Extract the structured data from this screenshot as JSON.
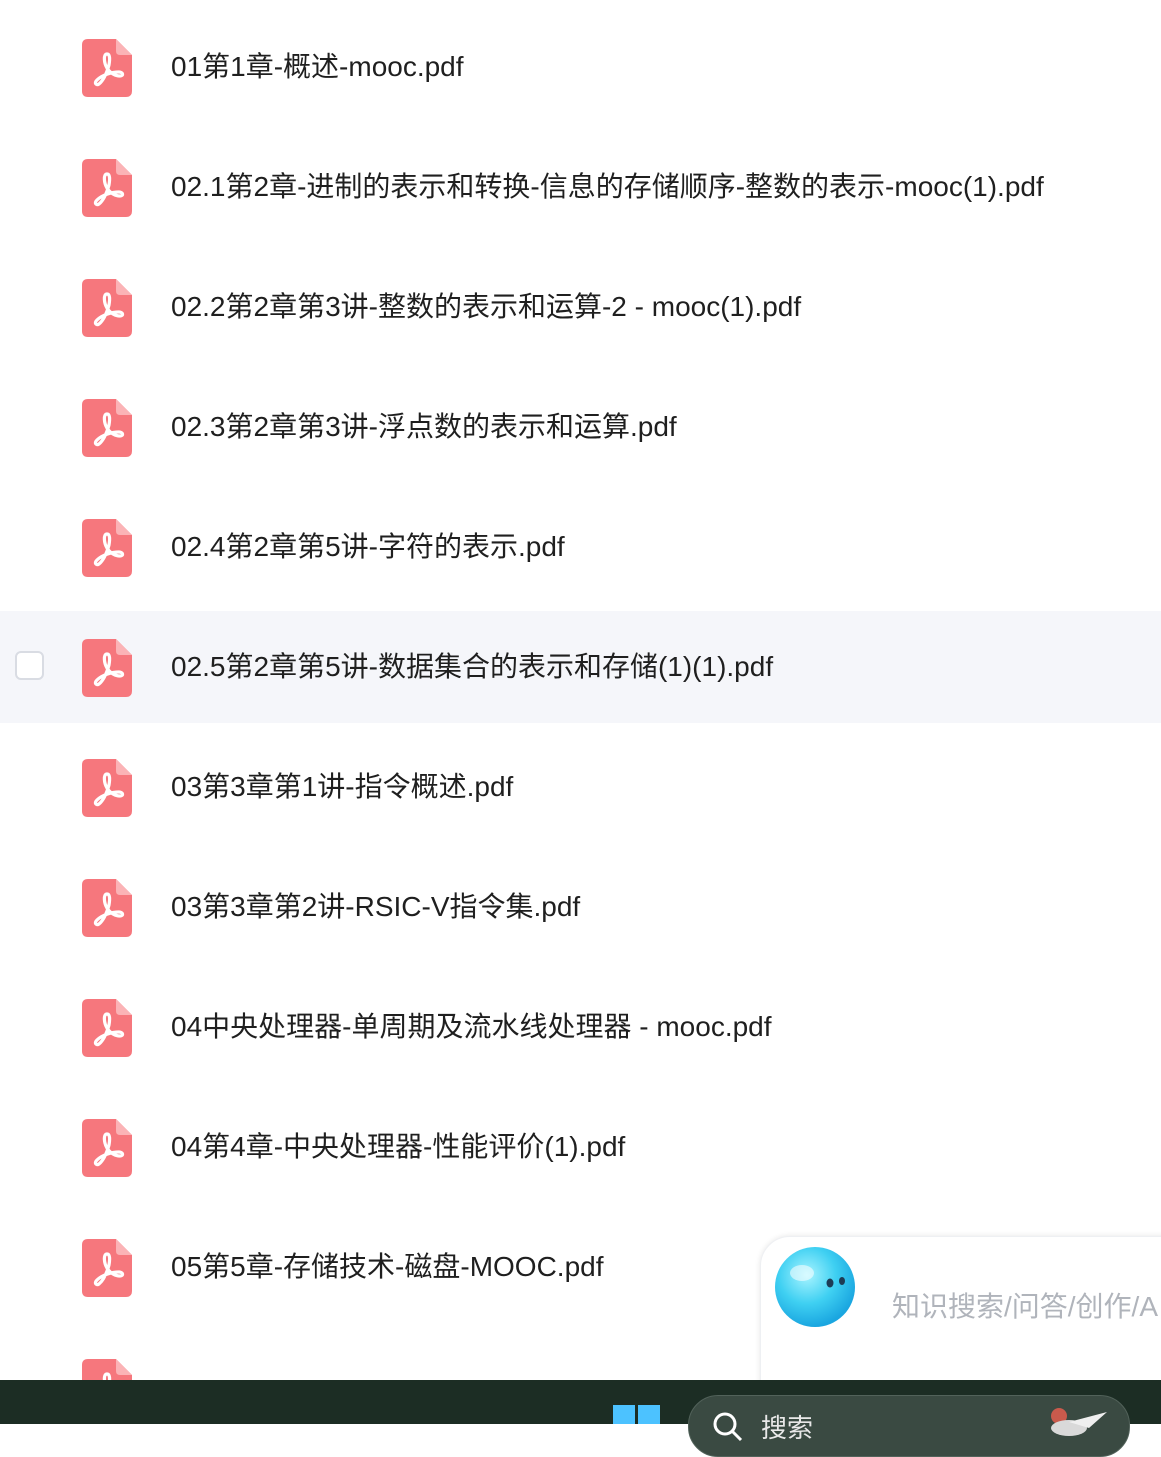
{
  "files": [
    {
      "name": "01第1章-概述-mooc.pdf",
      "icon": "pdf-icon"
    },
    {
      "name": "02.1第2章-进制的表示和转换-信息的存储顺序-整数的表示-mooc(1).pdf",
      "icon": "pdf-icon"
    },
    {
      "name": "02.2第2章第3讲-整数的表示和运算-2 - mooc(1).pdf",
      "icon": "pdf-icon"
    },
    {
      "name": "02.3第2章第3讲-浮点数的表示和运算.pdf",
      "icon": "pdf-icon"
    },
    {
      "name": "02.4第2章第5讲-字符的表示.pdf",
      "icon": "pdf-icon"
    },
    {
      "name": "02.5第2章第5讲-数据集合的表示和存储(1)(1).pdf",
      "icon": "pdf-icon",
      "hovered": true
    },
    {
      "name": "03第3章第1讲-指令概述.pdf",
      "icon": "pdf-icon"
    },
    {
      "name": "03第3章第2讲-RSIC-V指令集.pdf",
      "icon": "pdf-icon"
    },
    {
      "name": "04中央处理器-单周期及流水线处理器 - mooc.pdf",
      "icon": "pdf-icon"
    },
    {
      "name": "04第4章-中央处理器-性能评价(1).pdf",
      "icon": "pdf-icon"
    },
    {
      "name": "05第5章-存储技术-磁盘-MOOC.pdf",
      "icon": "pdf-icon"
    },
    {
      "name": "",
      "icon": "pdf-icon"
    }
  ],
  "assistant": {
    "placeholder": "知识搜索/问答/创作/A"
  },
  "taskbar": {
    "search_label": "搜索"
  },
  "colors": {
    "pdf_icon": "#f6777d",
    "row_hover": "#f5f6fa",
    "taskbar": "#1c2d24",
    "windows_accent": "#4cc2ff"
  }
}
